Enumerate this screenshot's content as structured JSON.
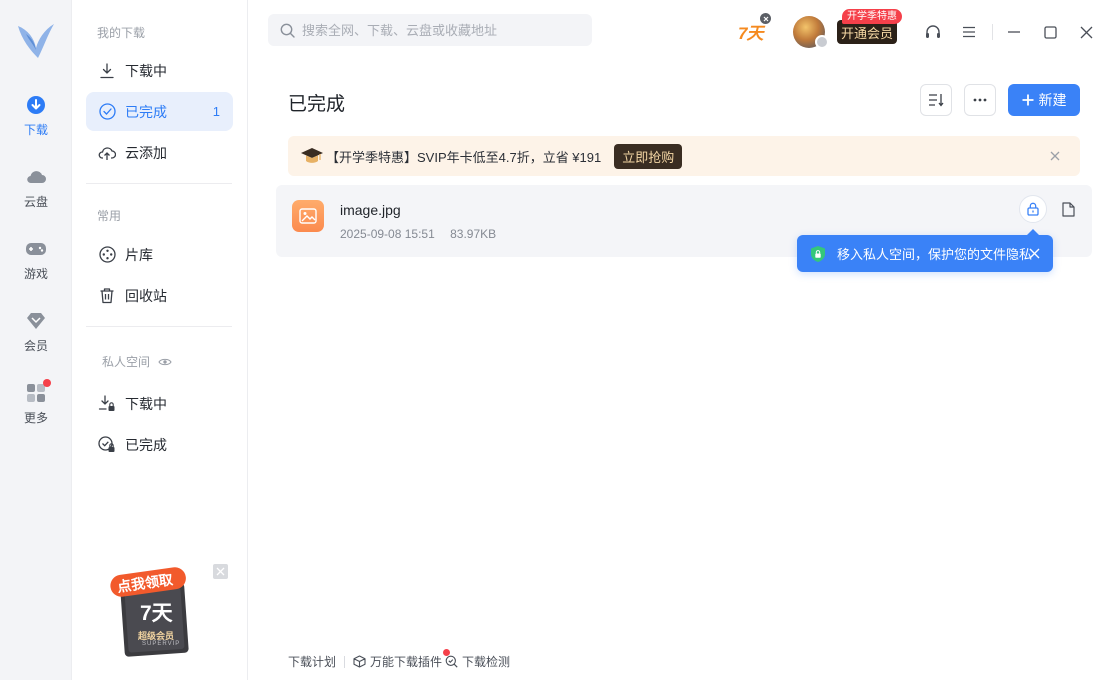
{
  "app": {
    "accent": "#3a82f7"
  },
  "rail": {
    "items": [
      {
        "label": "下载",
        "icon": "download-icon"
      },
      {
        "label": "云盘",
        "icon": "cloud-icon"
      },
      {
        "label": "游戏",
        "icon": "gamepad-icon"
      },
      {
        "label": "会员",
        "icon": "diamond-icon"
      },
      {
        "label": "更多",
        "icon": "grid-icon"
      }
    ]
  },
  "sidebar": {
    "my_downloads_title": "我的下载",
    "items": [
      {
        "label": "下载中",
        "icon": "download-arrow-icon"
      },
      {
        "label": "已完成",
        "icon": "check-circle-icon",
        "count": "1"
      },
      {
        "label": "云添加",
        "icon": "cloud-upload-icon"
      }
    ],
    "common_title": "常用",
    "common_items": [
      {
        "label": "片库",
        "icon": "film-reel-icon"
      },
      {
        "label": "回收站",
        "icon": "trash-icon"
      }
    ],
    "private_title": "私人空间",
    "private_items": [
      {
        "label": "下载中",
        "icon": "download-lock-icon"
      },
      {
        "label": "已完成",
        "icon": "check-lock-icon"
      }
    ],
    "promo": {
      "line1": "点我领取",
      "line2": "7天",
      "line3": "超级会员",
      "line4": "SUPERVIP"
    }
  },
  "topbar": {
    "search_placeholder": "搜索全网、下载、云盘或收藏地址",
    "days_badge": "7天",
    "vip_tag": "开学季特惠",
    "vip_button": "开通会员"
  },
  "main": {
    "title": "已完成",
    "new_button": "新建",
    "banner": {
      "text": "【开学季特惠】SVIP年卡低至4.7折，立省 ¥191",
      "button": "立即抢购"
    },
    "files": [
      {
        "name": "image.jpg",
        "date": "2025-09-08 15:51",
        "size": "83.97KB"
      }
    ],
    "tooltip": "移入私人空间，保护您的文件隐私",
    "footer": {
      "plan": "下载计划",
      "plugin": "万能下载插件",
      "check": "下载检测"
    }
  }
}
